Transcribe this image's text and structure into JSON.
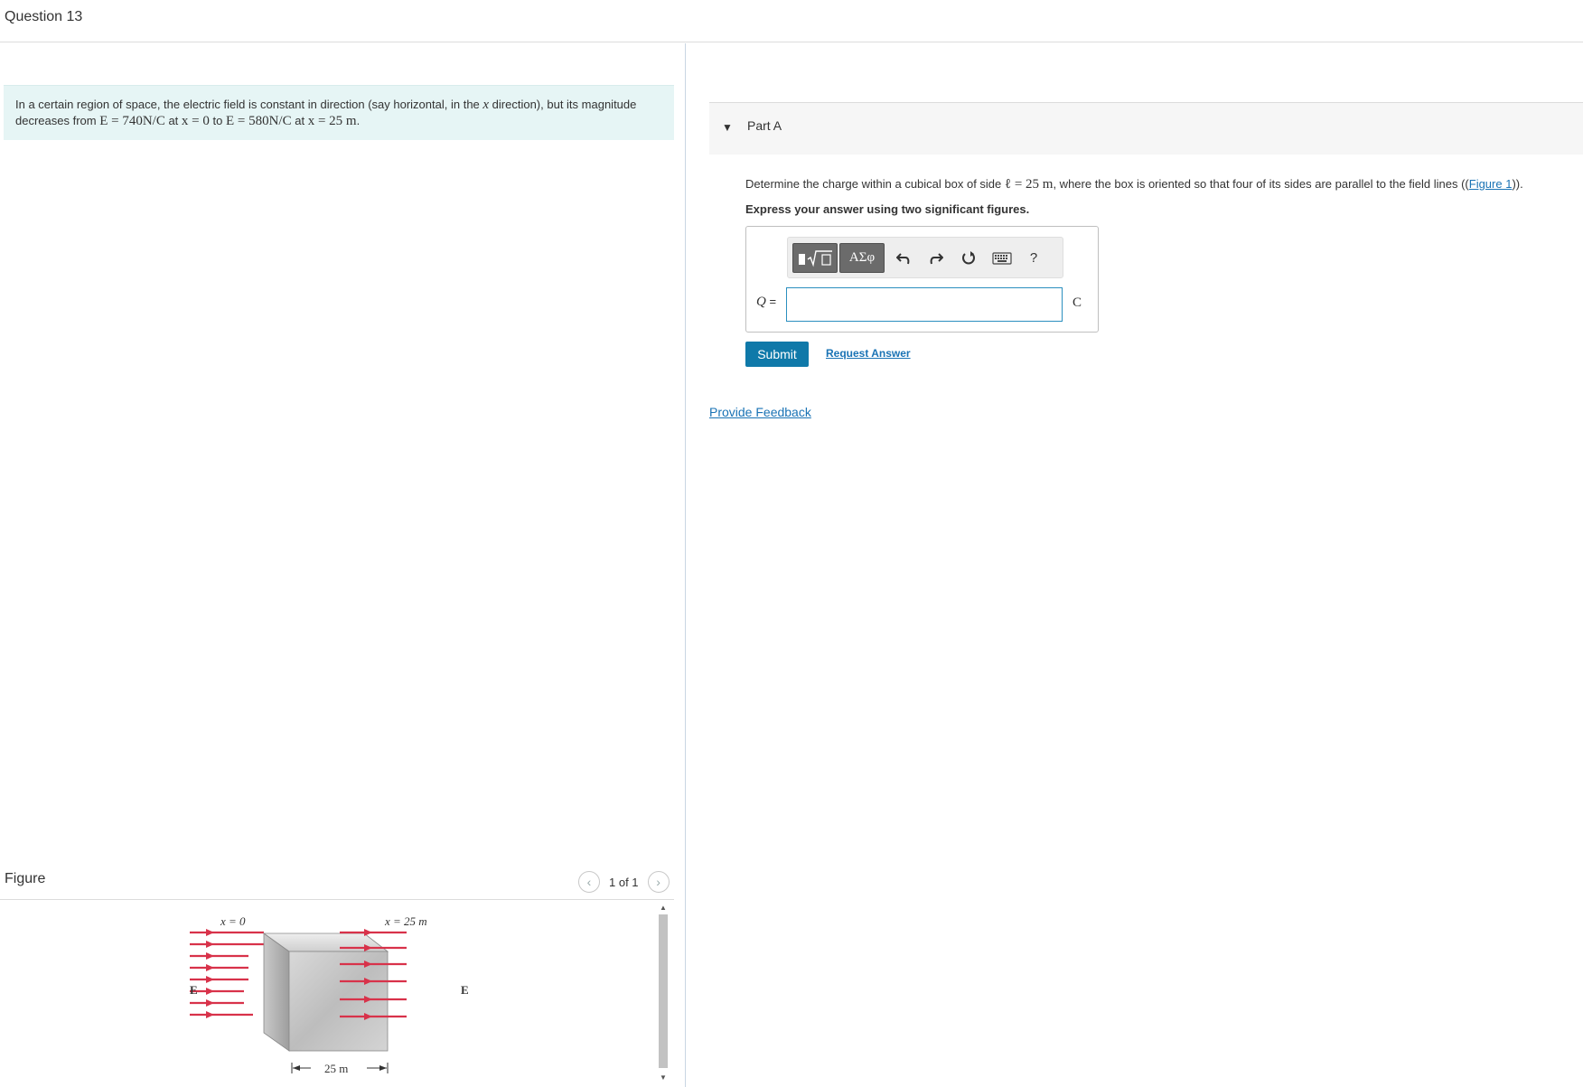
{
  "header": {
    "question_title": "Question 13"
  },
  "problem": {
    "text_1": "In a certain region of space, the electric field is constant in direction (say horizontal, in the ",
    "math_x": "x",
    "text_2": " direction), but its magnitude",
    "text_3": "decreases from ",
    "math_E1": "E = 740N/C",
    "text_at1": " at ",
    "math_x0": "x = 0",
    "text_to": " to ",
    "math_E2": "E = 580N/C",
    "text_at2": " at ",
    "math_x25": "x = 25 m",
    "text_end": "."
  },
  "part_a": {
    "title": "Part A",
    "prompt_1": "Determine the charge within a cubical box of side ",
    "prompt_math": "ℓ = 25 m",
    "prompt_2": ", where the box is oriented so that four of its sides are parallel to the field lines ((",
    "prompt_link": "Figure 1",
    "prompt_3": ")).",
    "instruction": "Express your answer using two significant figures.",
    "toolbar": {
      "templates_icon": "square-root-template-icon",
      "greek_label": "ΑΣφ",
      "undo_icon": "undo-icon",
      "redo_icon": "redo-icon",
      "reset_icon": "reset-icon",
      "keyboard_icon": "keyboard-icon",
      "help_label": "?"
    },
    "answer_label": "Q",
    "answer_eq": " =",
    "answer_value": "",
    "unit": "C",
    "submit_label": "Submit",
    "request_label": "Request Answer"
  },
  "feedback_label": "Provide Feedback",
  "figure": {
    "title": "Figure",
    "pager": "1 of 1",
    "label_x0": "x = 0",
    "label_x25": "x = 25 m",
    "label_E_left": "E",
    "label_E_right": "E",
    "label_side": "25 m",
    "field_color": "#d8324a"
  }
}
